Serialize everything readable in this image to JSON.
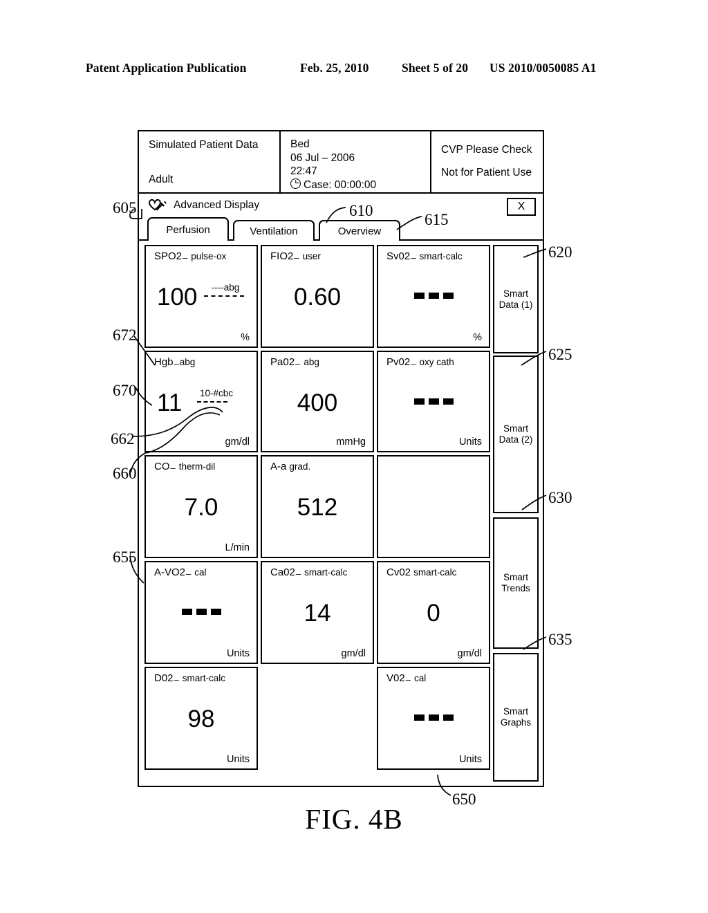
{
  "publication_header": {
    "left": "Patent Application Publication",
    "date": "Feb. 25, 2010",
    "sheet": "Sheet 5 of 20",
    "number": "US 2010/0050085 A1"
  },
  "figure_caption": "FIG. 4B",
  "patient_info": {
    "source_label": "Simulated Patient Data",
    "patient_type": "Adult",
    "bed_label": "Bed",
    "date": "06 Jul – 2006",
    "time": "22:47",
    "case_timer": "Case: 00:00:00",
    "clock_icon": "clock-icon",
    "alert_1": "CVP Please Check",
    "alert_2": "Not for Patient Use"
  },
  "titlebar": {
    "app_title": "Advanced Display",
    "app_icon": "heart-syringe-icon",
    "close_label": "X"
  },
  "tabs": [
    {
      "label": "Perfusion",
      "active": true
    },
    {
      "label": "Ventilation",
      "active": false
    },
    {
      "label": "Overview",
      "active": false
    }
  ],
  "tiles": [
    [
      {
        "abbr": "SPO2",
        "sep": "–",
        "source": "pulse-ox",
        "value": "100",
        "units": "%",
        "align": "left",
        "secondary": {
          "text": "----abg",
          "kind": "sec-spo2"
        }
      },
      {
        "abbr": "FIO2",
        "sep": "–",
        "source": "user",
        "value": "0.60",
        "units": "",
        "align": "center",
        "secondary": null
      },
      {
        "abbr": "Sv02",
        "sep": "–",
        "source": "smart-calc",
        "value": "---",
        "units": "%",
        "align": "center",
        "secondary": null
      }
    ],
    [
      {
        "abbr": "Hgb",
        "sep": "–",
        "source": "abg",
        "value": "11",
        "units": "gm/dl",
        "align": "left",
        "secondary": {
          "text": "10-#cbc",
          "kind": "sec-hgb"
        }
      },
      {
        "abbr": "Pa02",
        "sep": "–",
        "source": "abg",
        "value": "400",
        "units": "mmHg",
        "align": "center",
        "secondary": null
      },
      {
        "abbr": "Pv02",
        "sep": "–",
        "source": "oxy cath",
        "value": "---",
        "units": "Units",
        "align": "center",
        "secondary": null
      }
    ],
    [
      {
        "abbr": "CO",
        "sep": "–",
        "source": "therm-dil",
        "value": "7.0",
        "units": "L/min",
        "align": "center",
        "secondary": null
      },
      {
        "abbr": "A-a",
        "sep": "",
        "source": "grad.",
        "value": "512",
        "units": "",
        "align": "center",
        "secondary": null
      },
      {
        "abbr": "",
        "sep": "",
        "source": "",
        "value": "",
        "units": "",
        "align": "center",
        "secondary": null
      }
    ],
    [
      {
        "abbr": "A-VO2",
        "sep": "–",
        "source": "cal",
        "value": "---",
        "units": "Units",
        "align": "center",
        "secondary": null
      },
      {
        "abbr": "Ca02",
        "sep": "–",
        "source": "smart-calc",
        "value": "14",
        "units": "gm/dl",
        "align": "center",
        "secondary": null
      },
      {
        "abbr": "Cv02",
        "sep": "",
        "source": "smart-calc",
        "value": "0",
        "units": "gm/dl",
        "align": "center",
        "secondary": null
      }
    ],
    [
      {
        "abbr": "D02",
        "sep": "–",
        "source": "smart-calc",
        "value": "98",
        "units": "Units",
        "align": "center",
        "secondary": null
      },
      {
        "abbr": "",
        "sep": "",
        "source": "",
        "value": "",
        "units": "",
        "align": "center",
        "secondary": null,
        "hidden": true
      },
      {
        "abbr": "V02",
        "sep": "–",
        "source": "cal",
        "value": "---",
        "units": "Units",
        "align": "center",
        "secondary": null
      }
    ]
  ],
  "sidebar_buttons": [
    {
      "line1": "Smart",
      "line2": "Data (1)"
    },
    {
      "line1": "Smart",
      "line2": "Data (2)"
    },
    {
      "line1": "Smart",
      "line2": "Trends"
    },
    {
      "line1": "Smart",
      "line2": "Graphs"
    }
  ],
  "reference_numerals": {
    "n605": "605",
    "n610": "610",
    "n615": "615",
    "n620": "620",
    "n625": "625",
    "n630": "630",
    "n635": "635",
    "n650": "650",
    "n655": "655",
    "n660": "660",
    "n662": "662",
    "n670": "670",
    "n672": "672"
  }
}
